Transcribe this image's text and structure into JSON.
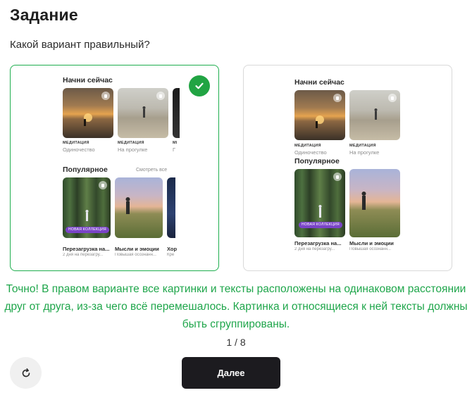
{
  "task": {
    "title": "Задание",
    "question": "Какой вариант правильный?"
  },
  "options": [
    {
      "selected": true,
      "correct": true,
      "mockup": {
        "section1_title": "Начни сейчас",
        "cards1": [
          {
            "category": "МЕДИТАЦИЯ",
            "subtitle": "Одиночество",
            "image": "sunset"
          },
          {
            "category": "МЕДИТАЦИЯ",
            "subtitle": "На прогулке",
            "image": "beach"
          },
          {
            "category": "МЕДИТАЦИЯ",
            "subtitle": "Г",
            "image": "dark"
          }
        ],
        "section2_title": "Популярное",
        "see_all": "Смотреть все",
        "cards2": [
          {
            "badge": "НОВАЯ КОЛЛЕКЦИЯ",
            "name": "Перезагрузка на...",
            "desc": "2 дня на перезагру...",
            "image": "forest"
          },
          {
            "name": "Мысли и эмоции",
            "desc": "Повышая осознанн...",
            "image": "field"
          },
          {
            "name": "Хор",
            "desc": "Кре",
            "image": "night"
          }
        ]
      }
    },
    {
      "selected": false,
      "correct": false,
      "mockup": {
        "section1_title": "Начни сейчас",
        "cards1": [
          {
            "category": "МЕДИТАЦИЯ",
            "subtitle": "Одиночество",
            "image": "sunset"
          },
          {
            "category": "МЕДИТАЦИЯ",
            "subtitle": "На прогулке",
            "image": "beach"
          }
        ],
        "section2_title": "Популярное",
        "cards2": [
          {
            "badge": "НОВАЯ КОЛЛЕКЦИЯ",
            "name": "Перезагрузка на...",
            "desc": "2 дня на перезагру...",
            "image": "forest"
          },
          {
            "name": "Мысли и эмоции",
            "desc": "Повышая осознанн...",
            "image": "field"
          }
        ]
      }
    }
  ],
  "feedback": {
    "text": "Точно! В правом варианте все картинки и тексты расположены на одинаковом расстоянии друг от друга, из-за чего всё перемешалось. Картинка и относящиеся к ней тексты должны быть сгруппированы.",
    "color": "#1fa64b"
  },
  "progress": {
    "counter": "1 / 8",
    "current": 1,
    "total": 8
  },
  "controls": {
    "next_label": "Далее",
    "refresh_icon": "refresh-icon"
  },
  "colors": {
    "correct_border": "#1fae4f",
    "check_badge": "#21a443",
    "primary_button": "#1c1b1f"
  }
}
